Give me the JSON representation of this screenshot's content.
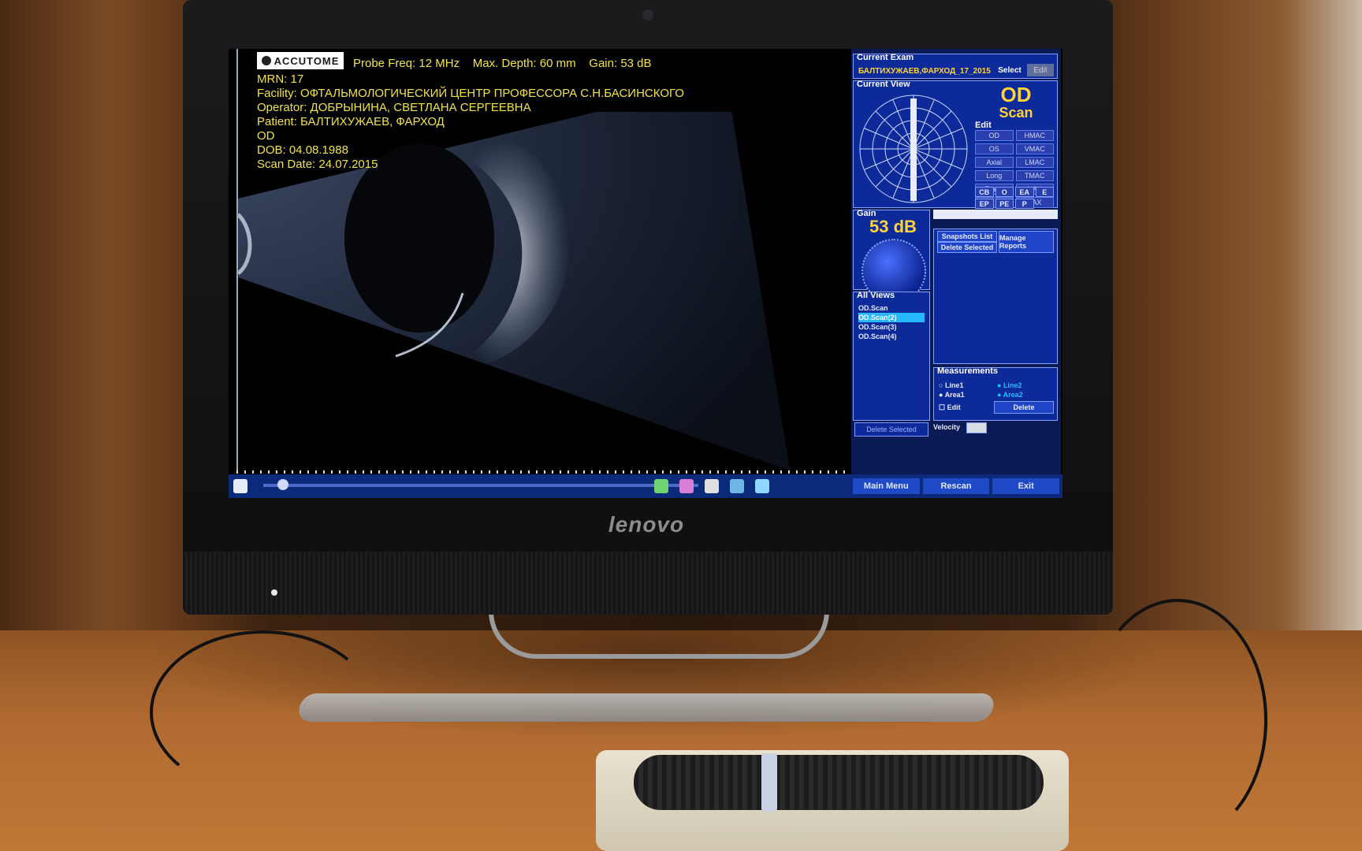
{
  "scene": {
    "monitor_brand": "lenovo"
  },
  "screen": {
    "logo": "ACCUTOME",
    "header": {
      "probe_freq": "Probe Freq: 12 MHz",
      "max_depth": "Max. Depth: 60 mm",
      "gain": "Gain: 53 dB"
    },
    "info": {
      "mrn": "MRN: 17",
      "facility": "Facility: ОФТАЛЬМОЛОГИЧЕСКИЙ ЦЕНТР ПРОФЕССОРА С.Н.БАСИНСКОГО",
      "operator": "Operator: ДОБРЫНИНА, СВЕТЛАНА СЕРГЕЕВНА",
      "patient": "Patient: БАЛТИХУЖАЕВ, ФАРХОД",
      "eye": "OD",
      "dob": "DOB: 04.08.1988",
      "scan_date": "Scan Date: 24.07.2015"
    },
    "right_panel": {
      "current_exam_title": "Current Exam",
      "current_exam_value": "БАЛТИХУЖАЕВ,ФАРХОД_17_2015",
      "select_label": "Select",
      "edit_label": "Edit",
      "current_view_title": "Current View",
      "eye_label": "OD",
      "mode_label": "Scan",
      "edit_group_title": "Edit",
      "view_buttons": [
        "OD",
        "HMAC",
        "OS",
        "VMAC",
        "Axial",
        "LMAC",
        "Long",
        "TMAC",
        "Trans",
        "HAX",
        "",
        "VAX"
      ],
      "marker_buttons": [
        "CB",
        "O",
        "EA",
        "E",
        "EP",
        "PE",
        "P"
      ],
      "gain_title": "Gain",
      "gain_value": "53 dB",
      "all_views_title": "All Views",
      "views": [
        "OD.Scan",
        "OD.Scan(2)",
        "OD.Scan(3)",
        "OD.Scan(4)"
      ],
      "selected_view_index": 1,
      "snapshots_label": "Snapshots List",
      "delete_selected_small": "Delete Selected",
      "manage_reports": "Manage Reports",
      "delete_selected": "Delete Selected",
      "measurements_title": "Measurements",
      "line1": "Line1",
      "line2": "Line2",
      "area1": "Area1",
      "area2": "Area2",
      "edit_check": "Edit",
      "delete_btn": "Delete",
      "velocity": "Velocity"
    },
    "bottom_bar": {
      "main_menu": "Main Menu",
      "rescan": "Rescan",
      "exit": "Exit",
      "palette_colors": [
        "#6fd36f",
        "#d97fd9",
        "#e0e0e0",
        "#6fb7e8",
        "#8fd9ff"
      ]
    }
  }
}
